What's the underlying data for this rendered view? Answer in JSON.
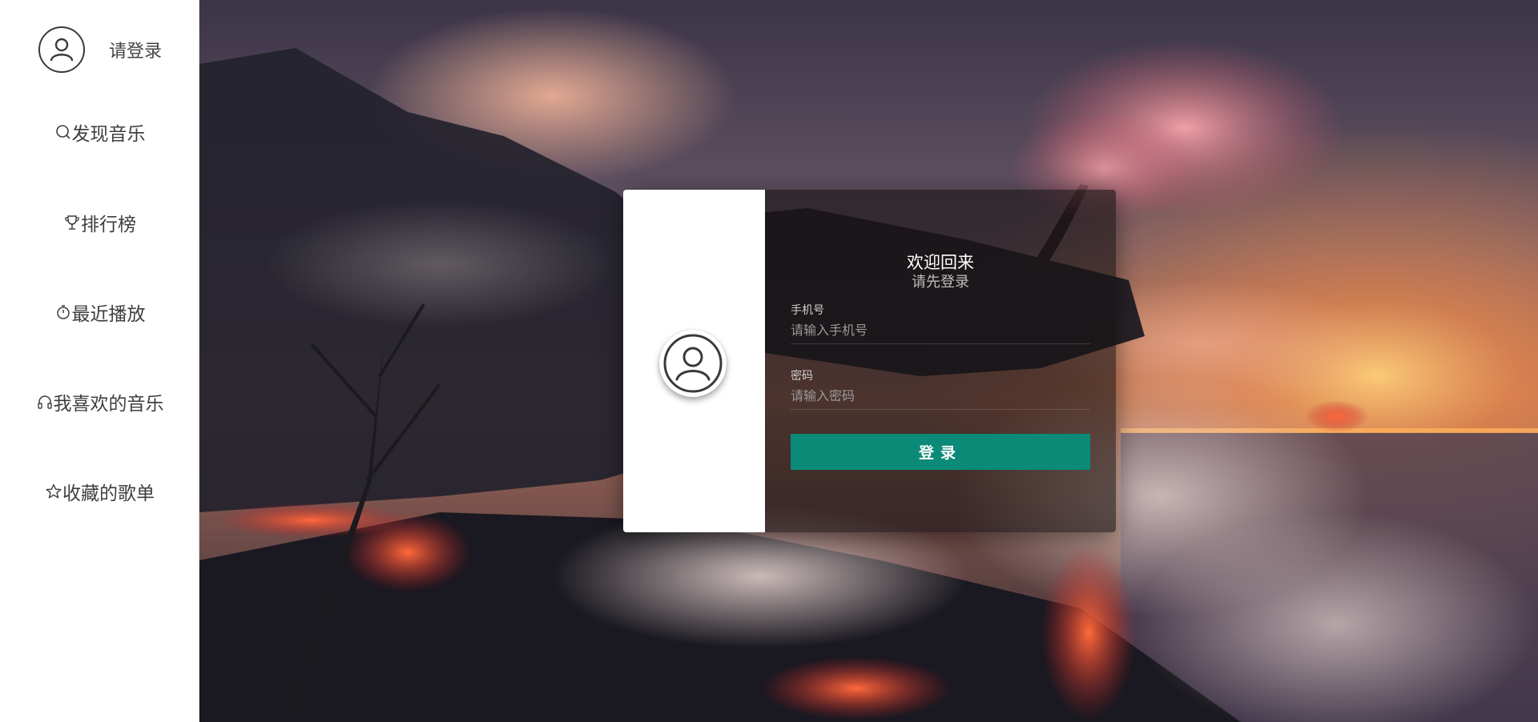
{
  "sidebar": {
    "profile": {
      "login_label": "请登录",
      "icon": "user-icon"
    },
    "items": [
      {
        "label": "发现音乐",
        "icon": "search-icon"
      },
      {
        "label": "排行榜",
        "icon": "trophy-icon"
      },
      {
        "label": "最近播放",
        "icon": "timer-icon"
      },
      {
        "label": "我喜欢的音乐",
        "icon": "headphones-icon"
      },
      {
        "label": "收藏的歌单",
        "icon": "star-icon"
      }
    ]
  },
  "login": {
    "title": "欢迎回来",
    "subtitle": "请先登录",
    "phone_label": "手机号",
    "phone_placeholder": "请输入手机号",
    "password_label": "密码",
    "password_placeholder": "请输入密码",
    "submit_label": "登录"
  },
  "colors": {
    "accent": "#0b8a77",
    "sidebar_bg": "#ffffff",
    "text": "#3e3e3e"
  }
}
